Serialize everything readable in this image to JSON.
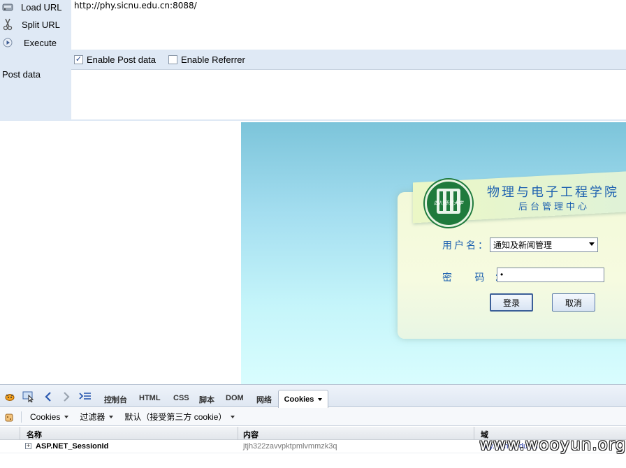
{
  "hackbar": {
    "load_url": "Load URL",
    "split_url": "Split URL",
    "execute": "Execute",
    "url_value": "http://phy.sicnu.edu.cn:8088/",
    "enable_post": "Enable Post data",
    "enable_post_checked": true,
    "enable_referrer": "Enable Referrer",
    "enable_referrer_checked": false,
    "post_data_label": "Post data",
    "post_data_value": ""
  },
  "login": {
    "logo_text": "四川师范大学",
    "college_title": "物理与电子工程学院",
    "subtitle": "后台管理中心",
    "user_label": "用户名：",
    "user_selected": "通知及新闻管理",
    "pwd_label": "密 码：",
    "pwd_value": "•",
    "login_button": "登录",
    "cancel_button": "取消"
  },
  "firebug": {
    "tabs": [
      "控制台",
      "HTML",
      "CSS",
      "脚本",
      "DOM",
      "网络"
    ],
    "active_tab": "Cookies",
    "toolbar": {
      "cookies": "Cookies",
      "filter": "过滤器",
      "default": "默认（接受第三方 cookie）"
    },
    "columns": {
      "name": "名称",
      "content": "内容",
      "domain": "域"
    },
    "rows": [
      {
        "name": "ASP.NET_SessionId",
        "content": "jtjh322zavvpktpmlvmmzk3q",
        "domain": "phy.sicnu.edu.cn"
      }
    ]
  },
  "watermark": "www.wooyun.org"
}
